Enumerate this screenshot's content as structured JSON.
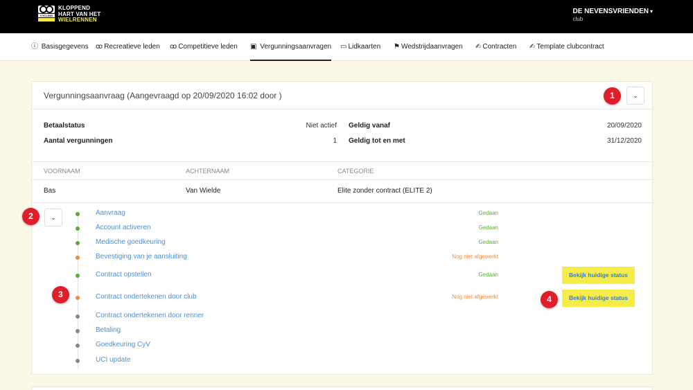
{
  "header": {
    "logo": {
      "line1": "KLOPPEND",
      "line2": "HART VAN HET",
      "line3": "WIELRENNEN",
      "badge_text": "CYCLING"
    },
    "club_name": "DE NEVENSVRIENDEN",
    "club_sub": "club"
  },
  "tabs": [
    {
      "label": "Basisgegevens",
      "icon": "info-icon"
    },
    {
      "label": "Recreatieve leden",
      "icon": "bike-icon"
    },
    {
      "label": "Competitieve leden",
      "icon": "bike-icon"
    },
    {
      "label": "Vergunningsaanvragen",
      "icon": "badge-icon"
    },
    {
      "label": "Lidkaarten",
      "icon": "card-icon"
    },
    {
      "label": "Wedstrijdaanvragen",
      "icon": "flag-icon"
    },
    {
      "label": "Contracten",
      "icon": "sign-icon"
    },
    {
      "label": "Template clubcontract",
      "icon": "sign-icon"
    }
  ],
  "request": {
    "title": "Vergunningsaanvraag (Aangevraagd op 20/09/2020 16:02 door )",
    "betaalstatus_label": "Betaalstatus",
    "betaalstatus_value": "Niet actief",
    "aantal_label": "Aantal vergunningen",
    "aantal_value": "1",
    "geldig_vanaf_label": "Geldig vanaf",
    "geldig_vanaf_value": "20/09/2020",
    "geldig_tot_label": "Geldig tot en met",
    "geldig_tot_value": "31/12/2020"
  },
  "table": {
    "headers": [
      "VOORNAAM",
      "ACHTERNAAM",
      "CATEGORIE"
    ],
    "row": [
      "Bas",
      "Van Wielde",
      "Elite zonder contract (ELITE 2)"
    ]
  },
  "steps": [
    {
      "name": "Aanvraag",
      "status": "Gedaan",
      "state": "done"
    },
    {
      "name": "Account activeren",
      "status": "Gedaan",
      "state": "done"
    },
    {
      "name": "Medische goedkeuring",
      "status": "Gedaan",
      "state": "done"
    },
    {
      "name": "Bevestiging van je aansluiting",
      "status": "Nog niet afgewerkt",
      "state": "open"
    },
    {
      "name": "Contract opstellen",
      "status": "Gedaan",
      "state": "done",
      "button": "Bekijk huidige status"
    },
    {
      "name": "Contract ondertekenen door club",
      "status": "Nog niet afgewerkt",
      "state": "open",
      "button": "Bekijk huidige status"
    },
    {
      "name": "Contract ondertekenen door renner",
      "status": "",
      "state": "pending"
    },
    {
      "name": "Betaling",
      "status": "",
      "state": "pending"
    },
    {
      "name": "Goedkeuring CyV",
      "status": "",
      "state": "pending"
    },
    {
      "name": "UCI update",
      "status": "",
      "state": "pending"
    }
  ],
  "markers": [
    "1",
    "2",
    "3",
    "4"
  ],
  "colors": {
    "done": "#5aae2f",
    "open": "#f08a3c",
    "pending": "#888888",
    "marker": "#e01e2b",
    "highlight": "#f5ec4a"
  }
}
